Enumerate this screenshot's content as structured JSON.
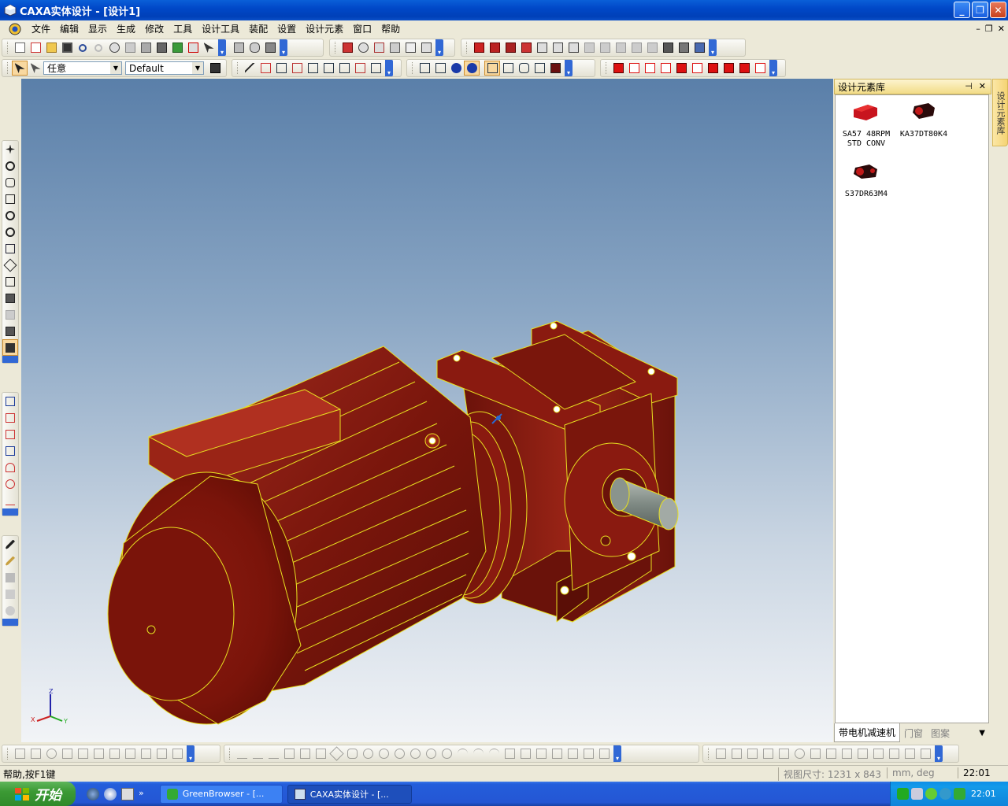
{
  "window": {
    "title": "CAXA实体设计 - [设计1]",
    "minimize": "_",
    "maximize": "❐",
    "close": "✕"
  },
  "menu": {
    "items": [
      "文件",
      "编辑",
      "显示",
      "生成",
      "修改",
      "工具",
      "设计工具",
      "装配",
      "设置",
      "设计元素",
      "窗口",
      "帮助"
    ],
    "mdi_controls": [
      "–",
      "❐",
      "✕"
    ]
  },
  "toolbar2": {
    "select_mode": "任意",
    "style": "Default"
  },
  "panel": {
    "title": "设计元素库",
    "pin": "⊣",
    "close": "✕",
    "items": [
      {
        "label": "SA57 48RPM STD CONV"
      },
      {
        "label": "KA37DT80K4"
      },
      {
        "label": "S37DR63M4"
      }
    ],
    "tabs": [
      "带电机减速机",
      "门窗",
      "图案"
    ],
    "dropdown": "▼",
    "side_tab": "设计元素库"
  },
  "axis": {
    "x": "X",
    "y": "Y",
    "z": "Z"
  },
  "status": {
    "help": "帮助,按F1键",
    "view_size": "视图尺寸: 1231 x 843",
    "units": "mm, deg",
    "time": "22:01"
  },
  "taskbar": {
    "start": "开始",
    "tasks": [
      "GreenBrowser - [...",
      "CAXA实体设计 - [..."
    ],
    "clock": "22:01"
  },
  "colors": {
    "model_red": "#8b1a10",
    "edge_yellow": "#e8e020",
    "shaft_gray": "#8b948e"
  }
}
